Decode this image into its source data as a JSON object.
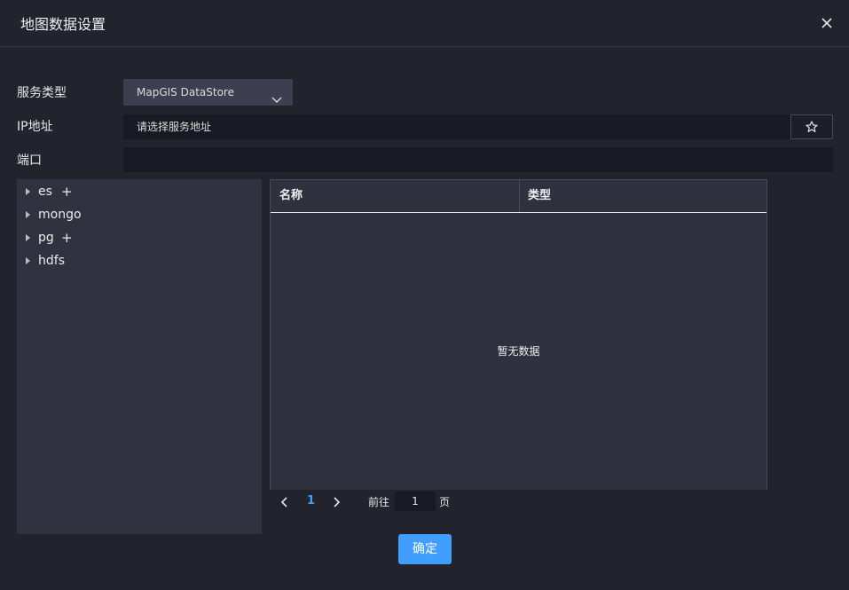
{
  "dialog": {
    "title": "地图数据设置"
  },
  "form": {
    "service_type_label": "服务类型",
    "service_type_value": "MapGIS DataStore",
    "ip_label": "IP地址",
    "ip_placeholder": "请选择服务地址",
    "port_label": "端口",
    "port_value": ""
  },
  "tree": {
    "nodes": [
      {
        "name": "es",
        "addable": true
      },
      {
        "name": "mongo",
        "addable": false
      },
      {
        "name": "pg",
        "addable": true
      },
      {
        "name": "hdfs",
        "addable": false
      }
    ],
    "add_symbol": "+"
  },
  "table": {
    "columns": [
      "名称",
      "类型"
    ],
    "empty_text": "暂无数据"
  },
  "pagination": {
    "current_page": "1",
    "goto_prefix": "前往",
    "goto_value": "1",
    "goto_suffix": "页"
  },
  "footer": {
    "confirm_label": "确定"
  },
  "colors": {
    "accent": "#409eff",
    "background": "#22232d",
    "panel": "#31323f"
  },
  "icons": [
    "close-icon",
    "chevron-down-icon",
    "star-icon",
    "caret-right-icon",
    "chevron-left-icon",
    "chevron-right-icon"
  ]
}
